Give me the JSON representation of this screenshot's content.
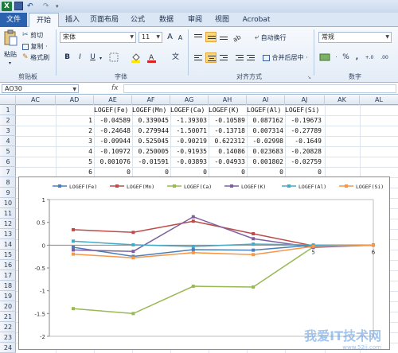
{
  "app": {
    "qat_logo": "X",
    "undo_glyph": "↶",
    "redo_glyph": "↷",
    "more_glyph": "▾"
  },
  "tabs": [
    {
      "label": "文件"
    },
    {
      "label": "开始"
    },
    {
      "label": "插入"
    },
    {
      "label": "页面布局"
    },
    {
      "label": "公式"
    },
    {
      "label": "数据"
    },
    {
      "label": "审阅"
    },
    {
      "label": "视图"
    },
    {
      "label": "Acrobat"
    }
  ],
  "ribbon": {
    "clipboard": {
      "paste_label": "粘贴",
      "cut_label": "剪切",
      "copy_label": "复制 ·",
      "format_painter_label": "格式刷",
      "group_label": "剪贴板"
    },
    "font": {
      "font_name": "宋体",
      "font_size": "11",
      "grow_label": "A",
      "shrink_label": "A",
      "bold_label": "B",
      "italic_label": "I",
      "underline_label": "U",
      "phonetic_label": "文",
      "group_label": "字体"
    },
    "alignment": {
      "wrap_label": "自动换行",
      "merge_label": "合并后居中 ·",
      "group_label": "对齐方式"
    },
    "number": {
      "format": "常规",
      "currency_label": "·",
      "percent_label": "%",
      "comma_label": ",",
      "inc_decimal_label": "+.0",
      "dec_decimal_label": ".00",
      "group_label": "数字"
    }
  },
  "formula_bar": {
    "name_box": "AO30",
    "fx_label": "fx",
    "formula": ""
  },
  "grid": {
    "columns": [
      "AC",
      "AD",
      "AE",
      "AF",
      "AG",
      "AH",
      "AI",
      "AJ",
      "AK",
      "AL"
    ],
    "rows": [
      "1",
      "2",
      "3",
      "4",
      "5",
      "6",
      "7",
      "8",
      "9",
      "10",
      "11",
      "12",
      "13",
      "14",
      "15",
      "16",
      "17",
      "18",
      "19",
      "20",
      "21",
      "22",
      "23",
      "24"
    ],
    "headers": [
      "LOGEF(Fe)",
      "LOGEF(Mn)",
      "LOGEF(Ca)",
      "LOGEF(K)",
      "LOGEF(Al)",
      "LOGEF(Si)"
    ],
    "data_rows": [
      {
        "idx": "1",
        "vals": [
          "-0.04589",
          "0.339045",
          "-1.39303",
          "-0.10589",
          "0.087162",
          "-0.19673"
        ]
      },
      {
        "idx": "2",
        "vals": [
          "-0.24648",
          "0.279944",
          "-1.50071",
          "-0.13718",
          "0.007314",
          "-0.27789"
        ]
      },
      {
        "idx": "3",
        "vals": [
          "-0.09944",
          "0.525045",
          "-0.90219",
          "0.622312",
          "-0.02998",
          "-0.1649"
        ]
      },
      {
        "idx": "4",
        "vals": [
          "-0.10972",
          "0.250005",
          "-0.91935",
          "0.14086",
          "0.023683",
          "-0.20828"
        ]
      },
      {
        "idx": "5",
        "vals": [
          "0.001076",
          "-0.01591",
          "-0.03893",
          "-0.04933",
          "0.001802",
          "-0.02759"
        ]
      },
      {
        "idx": "6",
        "vals": [
          "0",
          "0",
          "0",
          "0",
          "0",
          "0"
        ]
      }
    ]
  },
  "chart_data": {
    "type": "line",
    "x": [
      1,
      2,
      3,
      4,
      5,
      6
    ],
    "x_tick_labels": [
      "5",
      "6"
    ],
    "ylim": [
      -2,
      1
    ],
    "y_ticks": [
      "1",
      "0.5",
      "0",
      "-0.5",
      "-1",
      "-1.5",
      "-2"
    ],
    "legend_position": "top",
    "grid": false,
    "series": [
      {
        "name": "LOGEF(Fe)",
        "color": "#4a7ebb",
        "values": [
          -0.04589,
          -0.24648,
          -0.09944,
          -0.10972,
          0.001076,
          0
        ]
      },
      {
        "name": "LOGEF(Mn)",
        "color": "#be4b48",
        "values": [
          0.339045,
          0.279944,
          0.525045,
          0.250005,
          -0.01591,
          0
        ]
      },
      {
        "name": "LOGEF(Ca)",
        "color": "#98b954",
        "values": [
          -1.39303,
          -1.50071,
          -0.90219,
          -0.91935,
          -0.03893,
          0
        ]
      },
      {
        "name": "LOGEF(K)",
        "color": "#7d5fa0",
        "values": [
          -0.10589,
          -0.13718,
          0.622312,
          0.14086,
          -0.04933,
          0
        ]
      },
      {
        "name": "LOGEF(Al)",
        "color": "#46aac5",
        "values": [
          0.087162,
          0.007314,
          -0.02998,
          0.023683,
          0.001802,
          0
        ]
      },
      {
        "name": "LOGEF(Si)",
        "color": "#f79646",
        "values": [
          -0.19673,
          -0.27789,
          -0.1649,
          -0.20828,
          -0.02759,
          0
        ]
      }
    ]
  },
  "watermark": {
    "text": "我爱IT技术网",
    "sub": "www.52ij.com"
  }
}
